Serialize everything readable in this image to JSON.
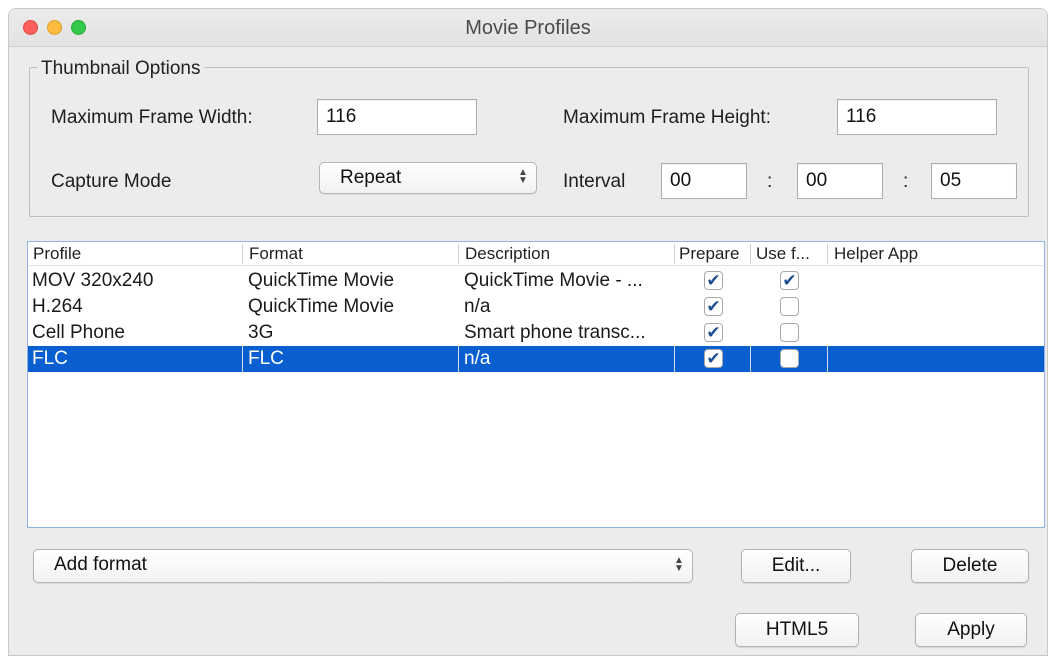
{
  "window": {
    "title": "Movie Profiles"
  },
  "thumbnail": {
    "group_label": "Thumbnail Options",
    "max_width_label": "Maximum Frame Width:",
    "max_width_value": "116",
    "max_height_label": "Maximum Frame Height:",
    "max_height_value": "116",
    "capture_mode_label": "Capture Mode",
    "capture_mode_value": "Repeat",
    "interval_label": "Interval",
    "interval_h": "00",
    "interval_sep1": ":",
    "interval_m": "00",
    "interval_sep2": ":",
    "interval_s": "05"
  },
  "table": {
    "columns": [
      "Profile",
      "Format",
      "Description",
      "Prepare",
      "Use f...",
      "Helper App"
    ],
    "rows": [
      {
        "profile": "MOV 320x240",
        "format": "QuickTime Movie",
        "description": "QuickTime Movie - ...",
        "prepare": true,
        "use": true,
        "helper": ""
      },
      {
        "profile": "H.264",
        "format": "QuickTime Movie",
        "description": "n/a",
        "prepare": true,
        "use": false,
        "helper": ""
      },
      {
        "profile": "Cell Phone",
        "format": "3G",
        "description": "Smart phone transc...",
        "prepare": true,
        "use": false,
        "helper": ""
      },
      {
        "profile": "FLC",
        "format": "FLC",
        "description": "n/a",
        "prepare": true,
        "use": false,
        "helper": "",
        "selected": true
      }
    ],
    "check_glyph": "✔"
  },
  "buttons": {
    "add_format": "Add format",
    "edit": "Edit...",
    "delete": "Delete",
    "html5": "HTML5",
    "apply": "Apply"
  },
  "colors": {
    "selection": "#0a5fd0",
    "table_border": "#8fb4e3"
  }
}
